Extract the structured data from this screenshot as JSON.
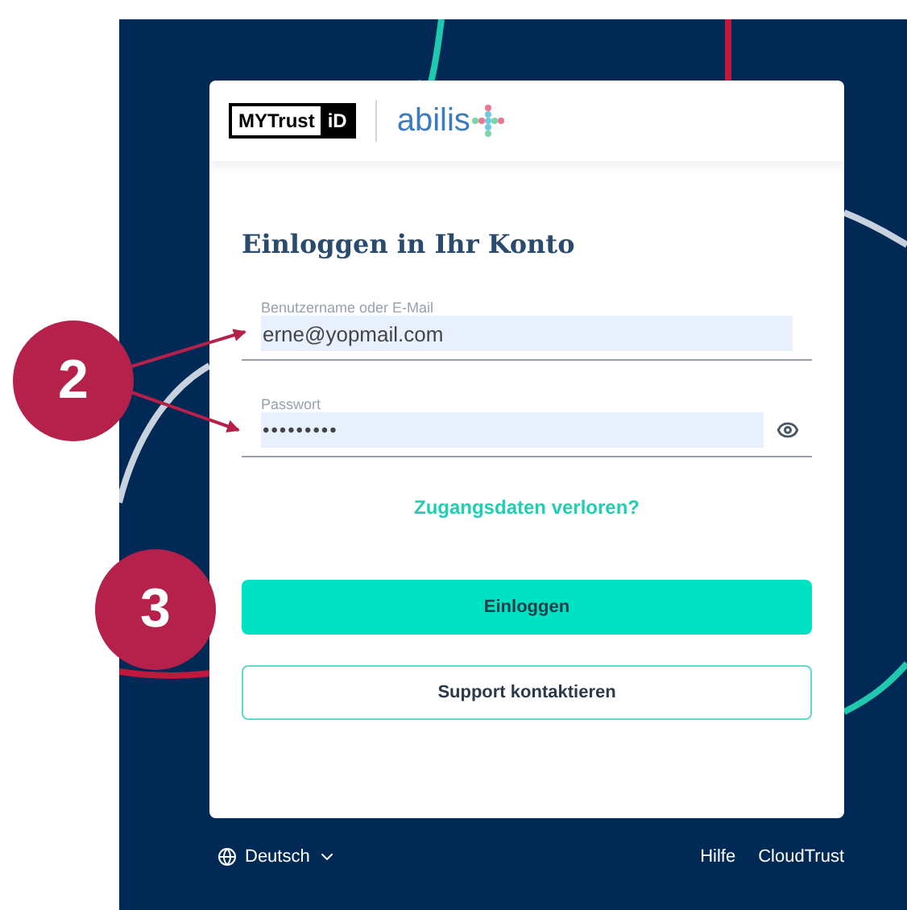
{
  "header": {
    "logo_left": {
      "text": "MYTrust",
      "badge": "iD"
    },
    "logo_right": {
      "text": "abilis"
    }
  },
  "title": "Einloggen in Ihr Konto",
  "fields": [
    {
      "label": "Benutzername oder E-Mail",
      "value": "erne@yopmail.com",
      "kind": "text"
    },
    {
      "label": "Passwort",
      "value": "•••••••••",
      "kind": "password"
    }
  ],
  "forgot_link": "Zugangsdaten verloren?",
  "buttons": [
    {
      "label": "Einloggen",
      "kind": "primary"
    },
    {
      "label": "Support kontaktieren",
      "kind": "secondary"
    }
  ],
  "footer": {
    "language": "Deutsch",
    "links": [
      "Hilfe",
      "CloudTrust"
    ]
  },
  "callouts": [
    {
      "label": "2"
    },
    {
      "label": "3"
    }
  ]
}
